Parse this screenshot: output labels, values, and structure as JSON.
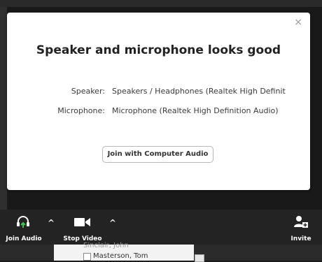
{
  "dialog": {
    "title": "Speaker and microphone looks good",
    "close_glyph": "×",
    "speaker_label": "Speaker:",
    "speaker_value": "Speakers / Headphones (Realtek High Definit",
    "microphone_label": "Microphone:",
    "microphone_value": "Microphone (Realtek High Definition Audio)",
    "join_button_label": "Join with Computer Audio"
  },
  "toolbar": {
    "join_audio_label": "Join Audio",
    "stop_video_label": "Stop Video",
    "invite_label": "Invite",
    "chevron_glyph": "^",
    "icons": [
      "headphones-icon",
      "video-camera-icon",
      "add-participant-icon"
    ]
  },
  "participants": {
    "partial_item": "Sinclair, John",
    "item": "Masterson, Tom"
  },
  "colors": {
    "toolbar_bg": "#232323",
    "dialog_bg": "#ffffff",
    "audio_arrow": "#3dc84b"
  }
}
